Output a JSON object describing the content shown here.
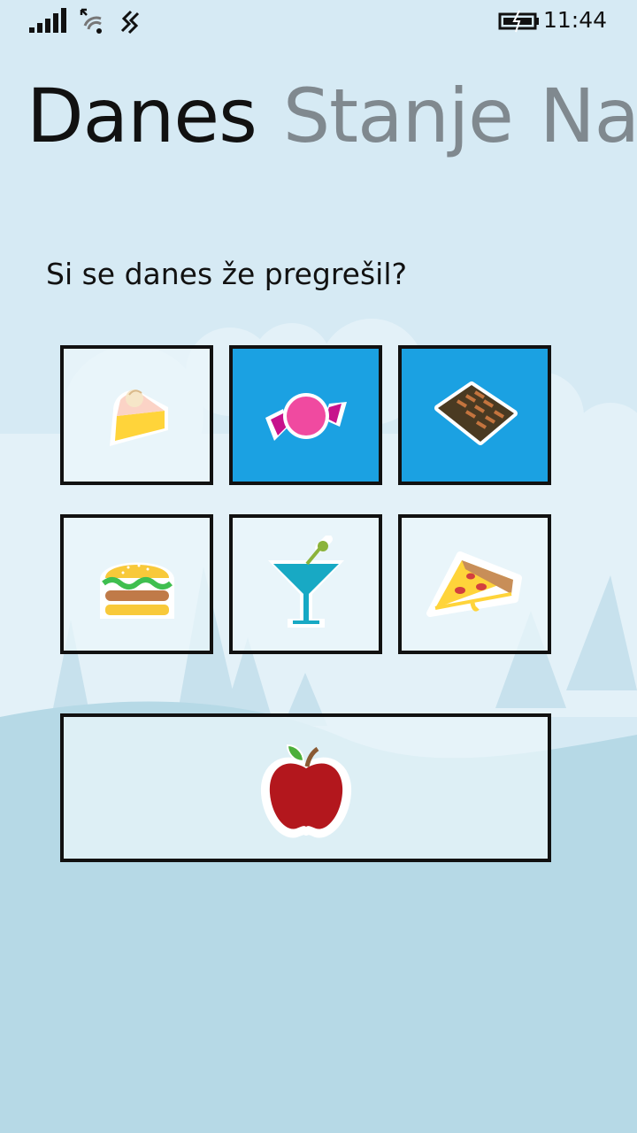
{
  "status_bar": {
    "time": "11:44",
    "icons": [
      "signal-strength-icon",
      "wifi-icon",
      "vibrate-icon",
      "battery-charging-icon"
    ]
  },
  "pivot": {
    "items": [
      {
        "label": "Danes",
        "active": true
      },
      {
        "label": "Stanje",
        "active": false
      },
      {
        "label": "Nas",
        "active": false
      }
    ]
  },
  "question": "Si se danes že pregrešil?",
  "tiles": [
    {
      "item": "cake-slice-icon",
      "selected": false
    },
    {
      "item": "candy-icon",
      "selected": true
    },
    {
      "item": "chocolate-bar-icon",
      "selected": true
    },
    {
      "item": "burger-icon",
      "selected": false
    },
    {
      "item": "cocktail-icon",
      "selected": false
    },
    {
      "item": "pizza-slice-icon",
      "selected": false
    },
    {
      "item": "apple-icon",
      "selected": false
    }
  ],
  "colors": {
    "accent": "#1ba1e2",
    "sky": "#d6eaf4",
    "hill": "#b6d9e6",
    "text_inactive": "#80898f"
  }
}
